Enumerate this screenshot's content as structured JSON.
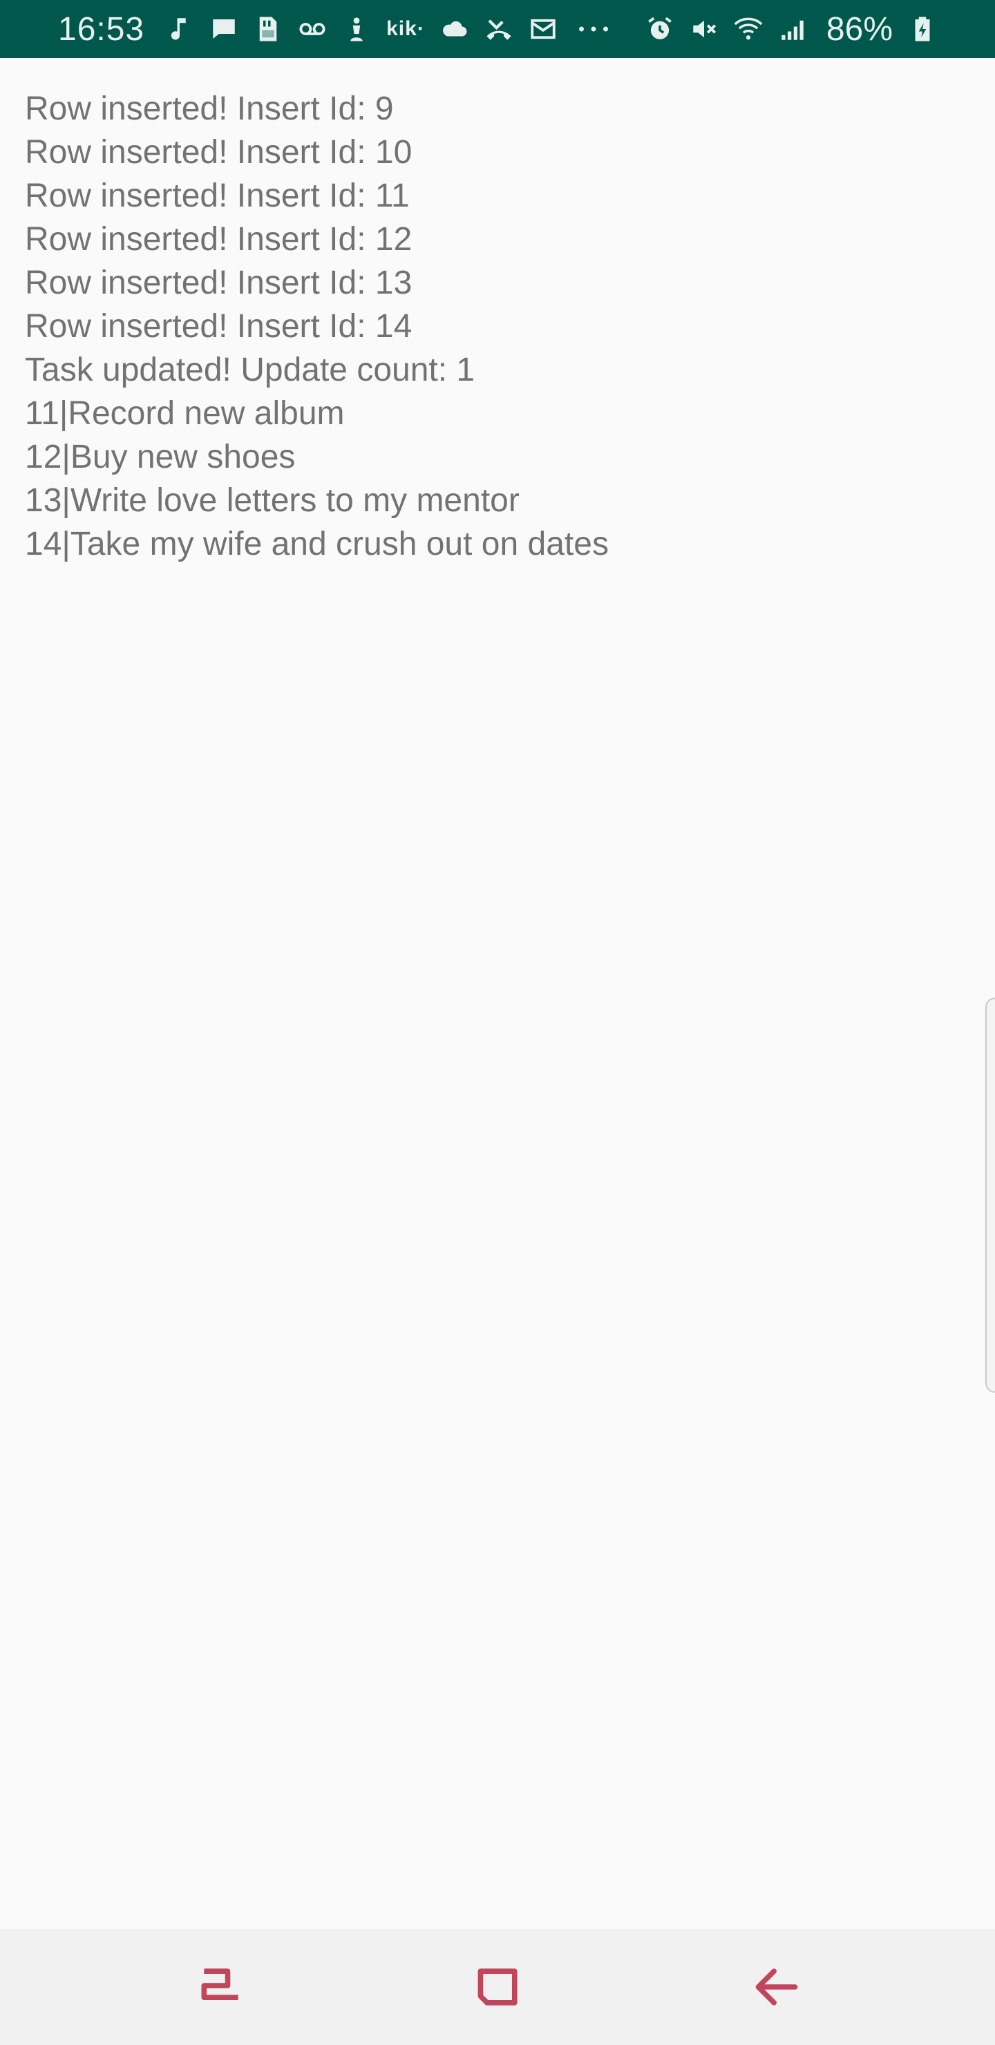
{
  "status_bar": {
    "time": "16:53",
    "kik_label": "kik·",
    "battery_percent": "86%",
    "background_color": "#00574b",
    "left_icons": [
      "music-note-icon",
      "chat-bubble-icon",
      "sd-card-icon",
      "voicemail-icon",
      "user-hint-icon",
      "kik-icon",
      "cloud-icon",
      "missed-call-icon",
      "email-icon",
      "more-dots-icon"
    ],
    "right_icons": [
      "alarm-icon",
      "mute-icon",
      "wifi-icon",
      "signal-icon",
      "battery-charging-icon"
    ]
  },
  "log": {
    "text_color": "#727272",
    "lines": [
      "Row inserted! Insert Id: 9",
      "Row inserted! Insert Id: 10",
      "Row inserted! Insert Id: 11",
      "Row inserted! Insert Id: 12",
      "Row inserted! Insert Id: 13",
      "Row inserted! Insert Id: 14",
      "Task updated! Update count: 1",
      "11|Record new album",
      "12|Buy new shoes",
      "13|Write love letters to my mentor",
      "14|Take my wife and crush out on dates"
    ]
  },
  "nav_bar": {
    "icon_color": "#c0465c",
    "buttons": [
      "recents-icon",
      "home-icon",
      "back-icon"
    ]
  }
}
